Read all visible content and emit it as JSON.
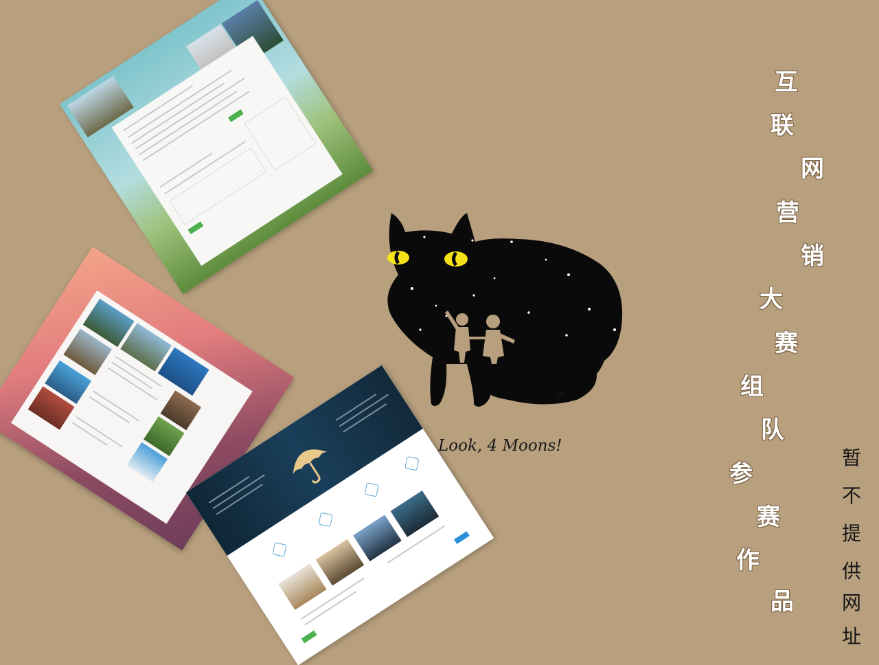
{
  "caption": "Look, 4 Moons!",
  "slogan": [
    "互",
    "联",
    "网",
    "营",
    "销",
    "大",
    "赛",
    "组",
    "队",
    "参",
    "赛",
    "作",
    "品"
  ],
  "note": [
    "暂",
    "不",
    "提",
    "供",
    "网",
    "址"
  ],
  "colors": {
    "background": "#b8a07e",
    "cat": "#0a0a0a",
    "cat_eyes": "#f5e21a",
    "umbrella": "#e8c98a",
    "slogan": "#ffffff"
  },
  "icons": [
    "black-cat-illustration",
    "umbrella-icon",
    "hexagon-icon"
  ]
}
